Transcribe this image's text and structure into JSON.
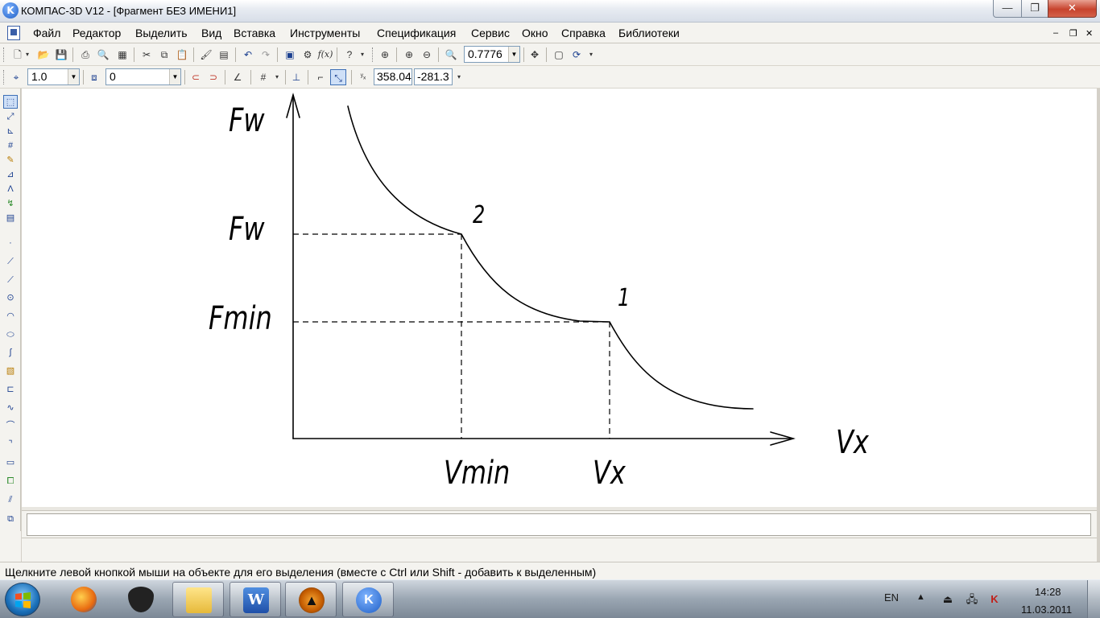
{
  "window": {
    "title": "КОМПАС-3D V12 - [Фрагмент БЕЗ ИМЕНИ1]",
    "min_glyph": "—",
    "max_glyph": "❐",
    "close_glyph": "✕"
  },
  "menu": {
    "items": [
      "Файл",
      "Редактор",
      "Выделить",
      "Вид",
      "Вставка",
      "Инструменты",
      "Спецификация",
      "Сервис",
      "Окно",
      "Справка",
      "Библиотеки"
    ],
    "mdi_min": "–",
    "mdi_restore": "❐",
    "mdi_close": "✕"
  },
  "toolbar1": {
    "fx_label": "f(x)",
    "zoom_value": "0.7776"
  },
  "toolbar2": {
    "line_style_value": "1.0",
    "layer_value": "0",
    "coord_x": "358.04",
    "coord_y": "-281.3"
  },
  "drawing": {
    "labels": {
      "fw_axis": "Fw",
      "fw_level": "Fw",
      "fmin_level": "Fmin",
      "point_2": "2",
      "point_1": "1",
      "vx_axis": "Vx",
      "vmin_tick": "Vmin",
      "vx_tick": "Vx"
    }
  },
  "status": {
    "hint": "Щелкните левой кнопкой мыши на объекте для его выделения (вместе с Ctrl или Shift - добавить к выделенным)"
  },
  "taskbar": {
    "tray_lang": "EN",
    "clock_time": "14:28",
    "clock_date": "11.03.2011"
  },
  "colors": {
    "close_button": "#c7432d",
    "selection_blue": "#3d6fb6",
    "canvas": "#ffffff",
    "drawing_line": "#000000"
  }
}
